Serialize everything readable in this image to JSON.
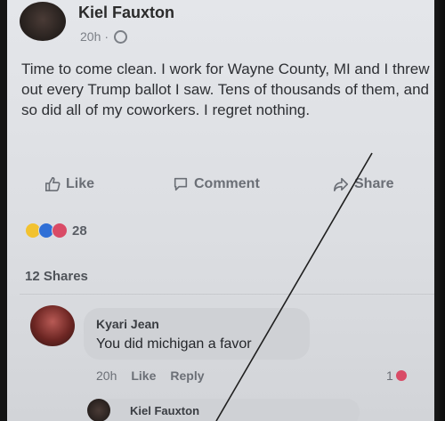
{
  "post": {
    "author": "Kiel Fauxton",
    "time": "20h",
    "separator": "·",
    "text": "Time to come clean. I work for Wayne County, MI and I threw out every Trump ballot I saw. Tens of thousands of them, and so did all of my coworkers. I regret nothing."
  },
  "actions": {
    "like": "Like",
    "comment": "Comment",
    "share": "Share"
  },
  "reactions": {
    "count": "28",
    "types": [
      "haha-icon",
      "like-icon",
      "love-icon"
    ]
  },
  "shares": "12 Shares",
  "comment": {
    "author": "Kyari Jean",
    "text": "You did michigan a favor",
    "time": "20h",
    "like": "Like",
    "reply": "Reply",
    "reaction_count": "1"
  },
  "reply_preview": {
    "author": "Kiel Fauxton"
  },
  "colors": {
    "background": "#dcdee2",
    "text": "#2d2f33",
    "muted": "#6b6f76",
    "love": "#d94b66",
    "like": "#2f6fd6"
  }
}
